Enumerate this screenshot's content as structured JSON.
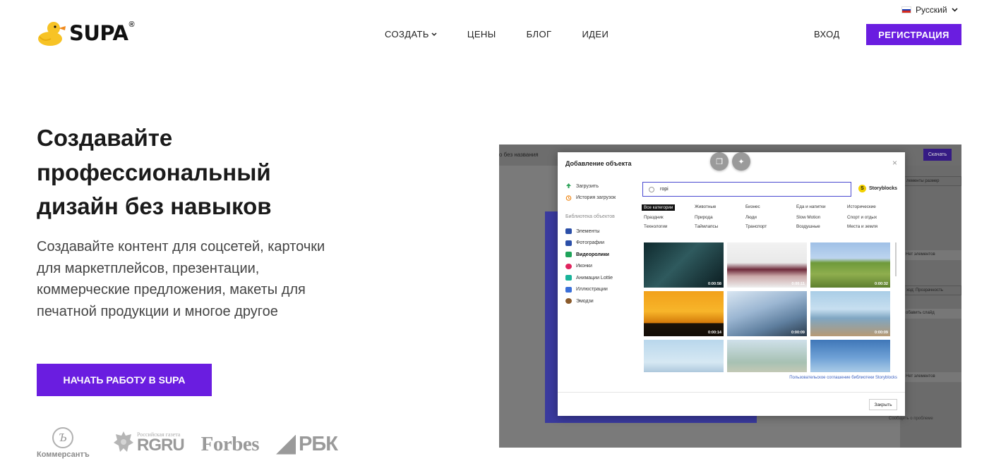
{
  "header": {
    "language": "Русский",
    "logo_text": "SUPA",
    "logo_mark": "®",
    "nav": [
      {
        "label": "СОЗДАТЬ",
        "has_dropdown": true
      },
      {
        "label": "ЦЕНЫ"
      },
      {
        "label": "БЛОГ"
      },
      {
        "label": "ИДЕИ"
      }
    ],
    "login": "ВХОД",
    "register": "РЕГИСТРАЦИЯ"
  },
  "hero": {
    "title": "Создавайте профессиональный дизайн без навыков",
    "subtitle": "Создавайте контент для соцсетей, карточки для маркетплейсов, презентации, коммерческие предложения, макеты для печатной продукции и многое другое",
    "cta": "НАЧАТЬ РАБОТУ В SUPA"
  },
  "press": {
    "kommersant_mark": "Ъ",
    "kommersant": "Коммерсантъ",
    "rg_small": "Российская газета",
    "rg_big": "RGRU",
    "forbes": "Forbes",
    "rbk": "РБК"
  },
  "colors": {
    "accent": "#6a1de0",
    "flag": [
      "#ffffff",
      "#1c3fb5",
      "#d52b1e"
    ]
  },
  "mockup": {
    "doc_title": "о без названия",
    "download": "Скачать",
    "right_panel": [
      "лементы размер",
      "Нет элементов",
      "ход: Прозрачность",
      "обавить слайд",
      "Нет элементов"
    ],
    "report": "Сообщить о проблеме",
    "modal": {
      "title": "Добавление объекта",
      "close_icon": "×",
      "upload": "Загрузить",
      "history": "История загрузок",
      "library_label": "Библиотека объектов",
      "library": [
        {
          "label": "Элементы",
          "icon": "shapes-icon",
          "color": "#2b4fa8"
        },
        {
          "label": "Фотографии",
          "icon": "photo-icon",
          "color": "#2b4fa8"
        },
        {
          "label": "Видеоролики",
          "icon": "video-icon",
          "color": "#1fa35a",
          "selected": true
        },
        {
          "label": "Иконки",
          "icon": "heart-icon",
          "color": "#e0245e"
        },
        {
          "label": "Анимации Lottie",
          "icon": "lottie-icon",
          "color": "#19b39a"
        },
        {
          "label": "Иллюстрации",
          "icon": "brush-icon",
          "color": "#3a6fd8"
        },
        {
          "label": "Эмодзи",
          "icon": "emoji-icon",
          "color": "#8a5a2b"
        }
      ],
      "search_value": "горі",
      "provider": "Storyblocks",
      "provider_mark": "S",
      "categories": [
        "Все категории",
        "Животные",
        "Бизнес",
        "Еда и напитки",
        "Исторические",
        "Праздник",
        "Природа",
        "Люди",
        "Slow Motion",
        "Спорт и отдых",
        "Технологии",
        "Таймлапсы",
        "Транспорт",
        "Воздушные",
        "Места и земля"
      ],
      "active_category": "Все категории",
      "videos": [
        {
          "duration": "0:00:58",
          "bg": "linear-gradient(135deg,#0f2a2e,#2f5a5e 45%,#0b1c20)"
        },
        {
          "duration": "0:00:11",
          "bg": "linear-gradient(180deg,#f2f2f2 0%,#e9e9e9 45%,#6e2a3a 60%,#caa 75%,#eee 100%)"
        },
        {
          "duration": "0:00:32",
          "bg": "linear-gradient(180deg,#9fc0e6 0%,#bcd4ef 35%,#6f9a3a 45%,#8fae4e 70%,#5d7f2f 100%)"
        },
        {
          "duration": "0:00:14",
          "bg": "linear-gradient(180deg,#f2a11a 0%,#f7b52a 45%,#d57b0a 70%,#1a1208 72%,#120c06 100%)"
        },
        {
          "duration": "0:00:09",
          "bg": "linear-gradient(160deg,#d9e6f2 0%,#9bb6d2 40%,#5f7f9f 70%,#2a3a4a 100%)"
        },
        {
          "duration": "0:00:09",
          "bg": "linear-gradient(180deg,#a9cde6 0%,#c7dff0 40%,#7fa6c2 60%,#b79a74 100%)"
        },
        {
          "duration": "",
          "bg": "linear-gradient(180deg,#b9d7ec 0%,#d6e8f3 50%,#7a9fbf 100%)"
        },
        {
          "duration": "",
          "bg": "linear-gradient(180deg,#cfe0ea 0%,#a7c1b3 50%,#e7d2b8 100%)"
        },
        {
          "duration": "",
          "bg": "linear-gradient(180deg,#3f77b8 0%,#6fa1d6 40%,#a7c9e6 70%,#7b8f9e 100%)"
        }
      ],
      "license_link": "Пользовательское соглашение библиотеки Storyblocks",
      "close_button": "Закрыть"
    }
  }
}
